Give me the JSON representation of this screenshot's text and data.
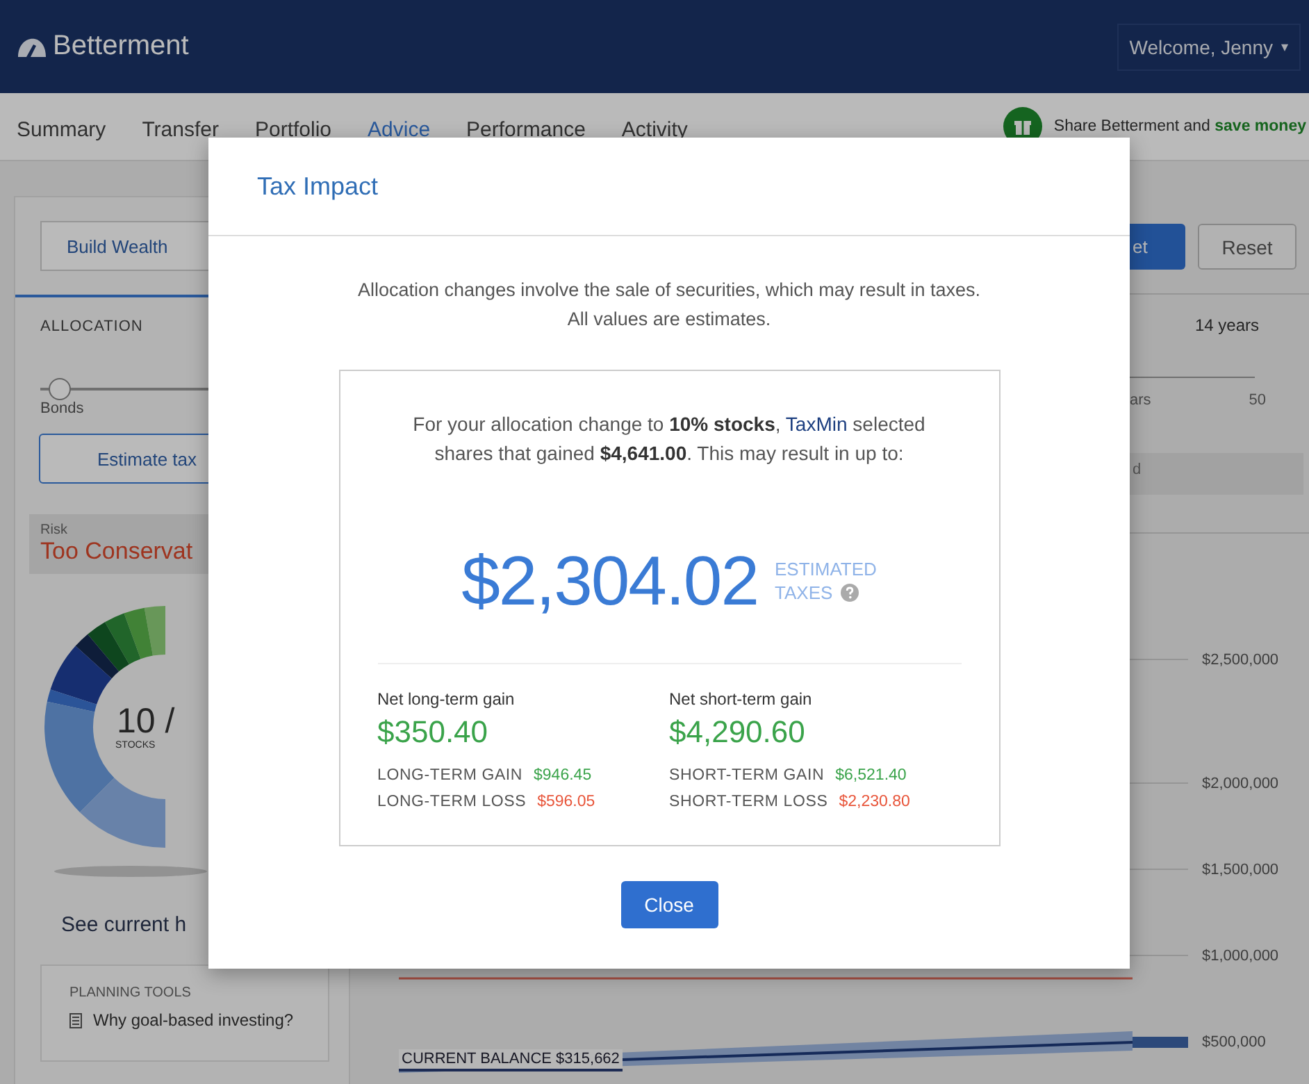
{
  "header": {
    "brand": "Betterment",
    "user_menu": "Welcome, Jenny",
    "caret": "▾"
  },
  "nav": {
    "tabs": [
      {
        "label": "Summary",
        "selected": false
      },
      {
        "label": "Transfer",
        "selected": false
      },
      {
        "label": "Portfolio",
        "selected": false
      },
      {
        "label": "Advice",
        "selected": true
      },
      {
        "label": "Performance",
        "selected": false
      },
      {
        "label": "Activity",
        "selected": false
      }
    ],
    "promo": "Share Betterment and **save money**"
  },
  "left_panel": {
    "goal_button": "Build Wealth",
    "allocation_label": "ALLOCATION",
    "slider": {
      "level": 0.1
    },
    "slider_label": "Bonds",
    "estimate_button": "Estimate tax",
    "risk": {
      "label": "Risk",
      "value": "Too Conservat"
    },
    "donut": {
      "value": "10 /",
      "caption": "STOCKS"
    },
    "holdings_link": "See current h"
  },
  "planning_tools": {
    "title": "PLANNING TOOLS",
    "items": [
      "Why goal-based investing?"
    ]
  },
  "right_panel": {
    "set_button": "et",
    "reset_button": "Reset",
    "horizon": "14 years",
    "scale_label": "ars",
    "scale_max": "50",
    "info_text": "d",
    "y_axis": [
      "$2,500,000",
      "$2,000,000",
      "$1,500,000",
      "$1,000,000",
      "$500,000"
    ],
    "balance_label": "CURRENT BALANCE $315,662"
  },
  "modal": {
    "title": "Tax Impact",
    "intro": [
      "Allocation changes involve the sale of securities, which may result in taxes.",
      "All values are estimates."
    ],
    "summary": {
      "before": "For your allocation change to **10% stocks**, ",
      "link": "TaxMin",
      "after": " selected shares that gained **$4,641.00**. This may result in up to:"
    },
    "amount": "$2,304.02",
    "amount_label": [
      "ESTIMATED",
      "TAXES"
    ],
    "columns": [
      {
        "title": "Net long-term gain",
        "value": "$350.40",
        "details": [
          {
            "label": "LONG-TERM GAIN",
            "value": "$946.45",
            "kind": "gain"
          },
          {
            "label": "LONG-TERM LOSS",
            "value": "$596.05",
            "kind": "loss"
          }
        ]
      },
      {
        "title": "Net short-term gain",
        "value": "$4,290.60",
        "details": [
          {
            "label": "SHORT-TERM GAIN",
            "value": "$6,521.40",
            "kind": "gain"
          },
          {
            "label": "SHORT-TERM LOSS",
            "value": "$2,230.80",
            "kind": "loss"
          }
        ]
      }
    ],
    "close_button": "Close"
  }
}
